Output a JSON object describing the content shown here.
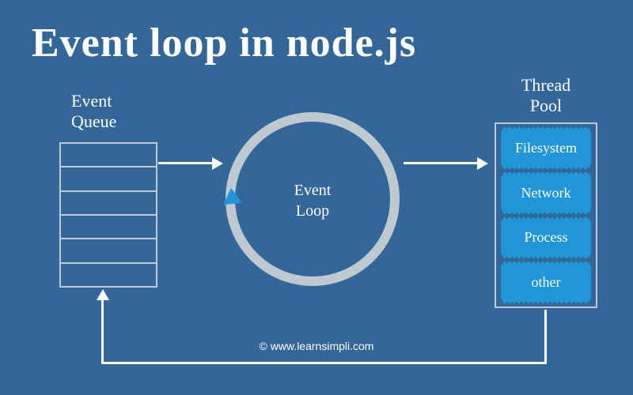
{
  "title": "Event loop in node.js",
  "queue": {
    "label_line1": "Event",
    "label_line2": "Queue",
    "rows": 6
  },
  "loop": {
    "label_line1": "Event",
    "label_line2": "Loop"
  },
  "pool": {
    "label_line1": "Thread",
    "label_line2": "Pool",
    "items": [
      "Filesystem",
      "Network",
      "Process",
      "other"
    ]
  },
  "credit": "© www.learnsimpli.com"
}
